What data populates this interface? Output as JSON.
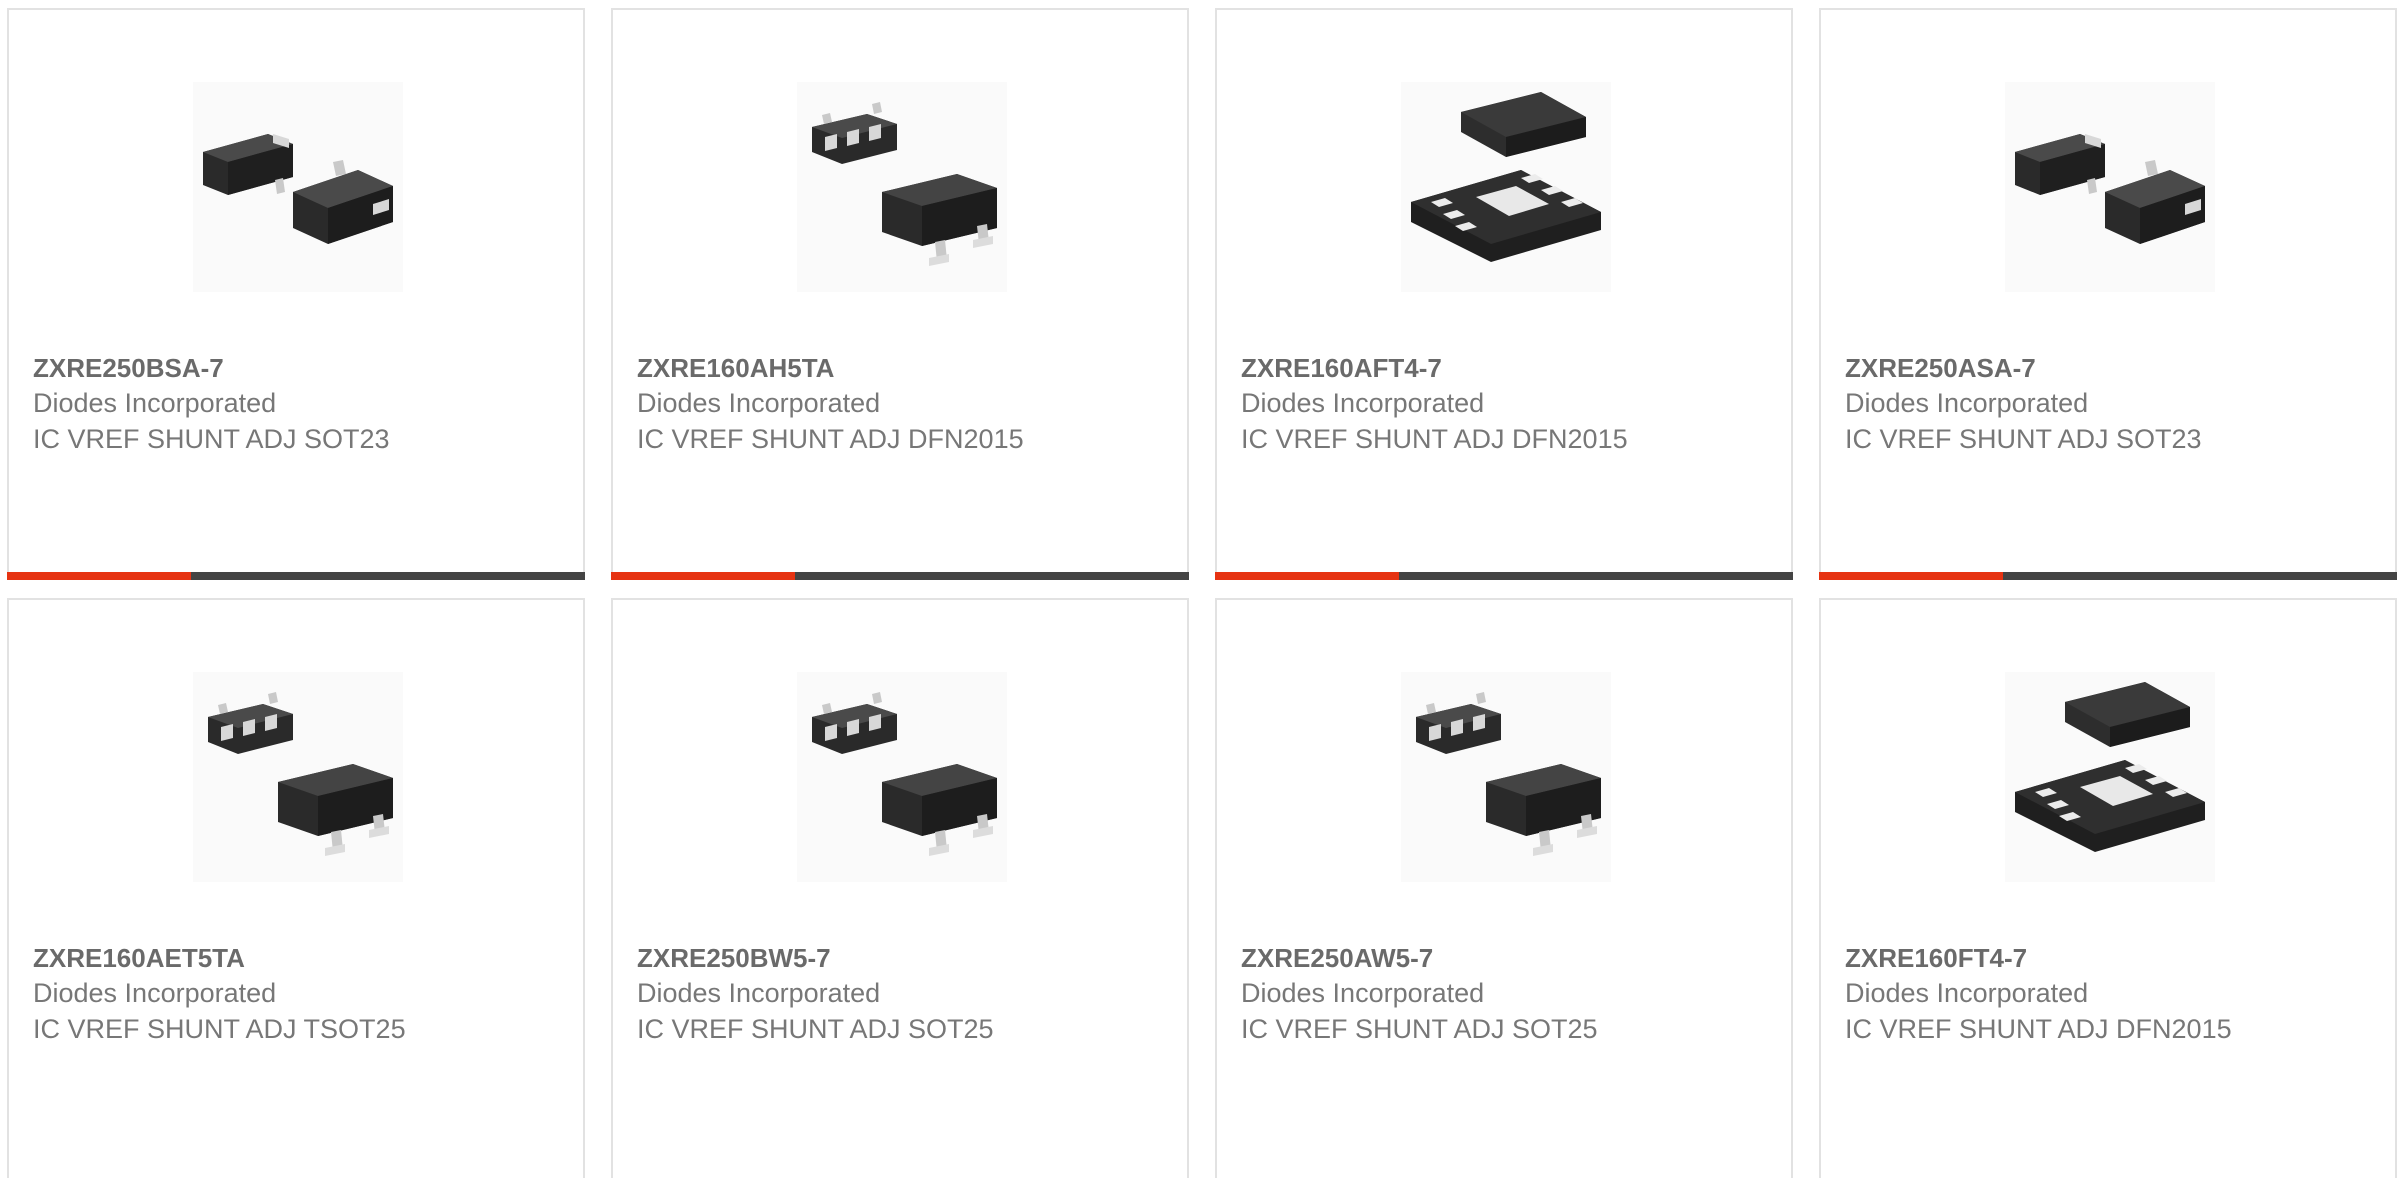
{
  "accent_color": "#e63312",
  "products": [
    {
      "part": "ZXRE250BSA-7",
      "manufacturer": "Diodes Incorporated",
      "description": "IC VREF SHUNT ADJ SOT23",
      "package_icon": "sot23-package-icon"
    },
    {
      "part": "ZXRE160AH5TA",
      "manufacturer": "Diodes Incorporated",
      "description": "IC VREF SHUNT ADJ DFN2015",
      "package_icon": "sot25-package-icon"
    },
    {
      "part": "ZXRE160AFT4-7",
      "manufacturer": "Diodes Incorporated",
      "description": "IC VREF SHUNT ADJ DFN2015",
      "package_icon": "dfn-package-icon"
    },
    {
      "part": "ZXRE250ASA-7",
      "manufacturer": "Diodes Incorporated",
      "description": "IC VREF SHUNT ADJ SOT23",
      "package_icon": "sot23-package-icon"
    },
    {
      "part": "ZXRE160AET5TA",
      "manufacturer": "Diodes Incorporated",
      "description": "IC VREF SHUNT ADJ TSOT25",
      "package_icon": "sot25-package-icon"
    },
    {
      "part": "ZXRE250BW5-7",
      "manufacturer": "Diodes Incorporated",
      "description": "IC VREF SHUNT ADJ SOT25",
      "package_icon": "sot25-package-icon"
    },
    {
      "part": "ZXRE250AW5-7",
      "manufacturer": "Diodes Incorporated",
      "description": "IC VREF SHUNT ADJ SOT25",
      "package_icon": "sot25-package-icon"
    },
    {
      "part": "ZXRE160FT4-7",
      "manufacturer": "Diodes Incorporated",
      "description": "IC VREF SHUNT ADJ DFN2015",
      "package_icon": "dfn-package-icon"
    }
  ]
}
